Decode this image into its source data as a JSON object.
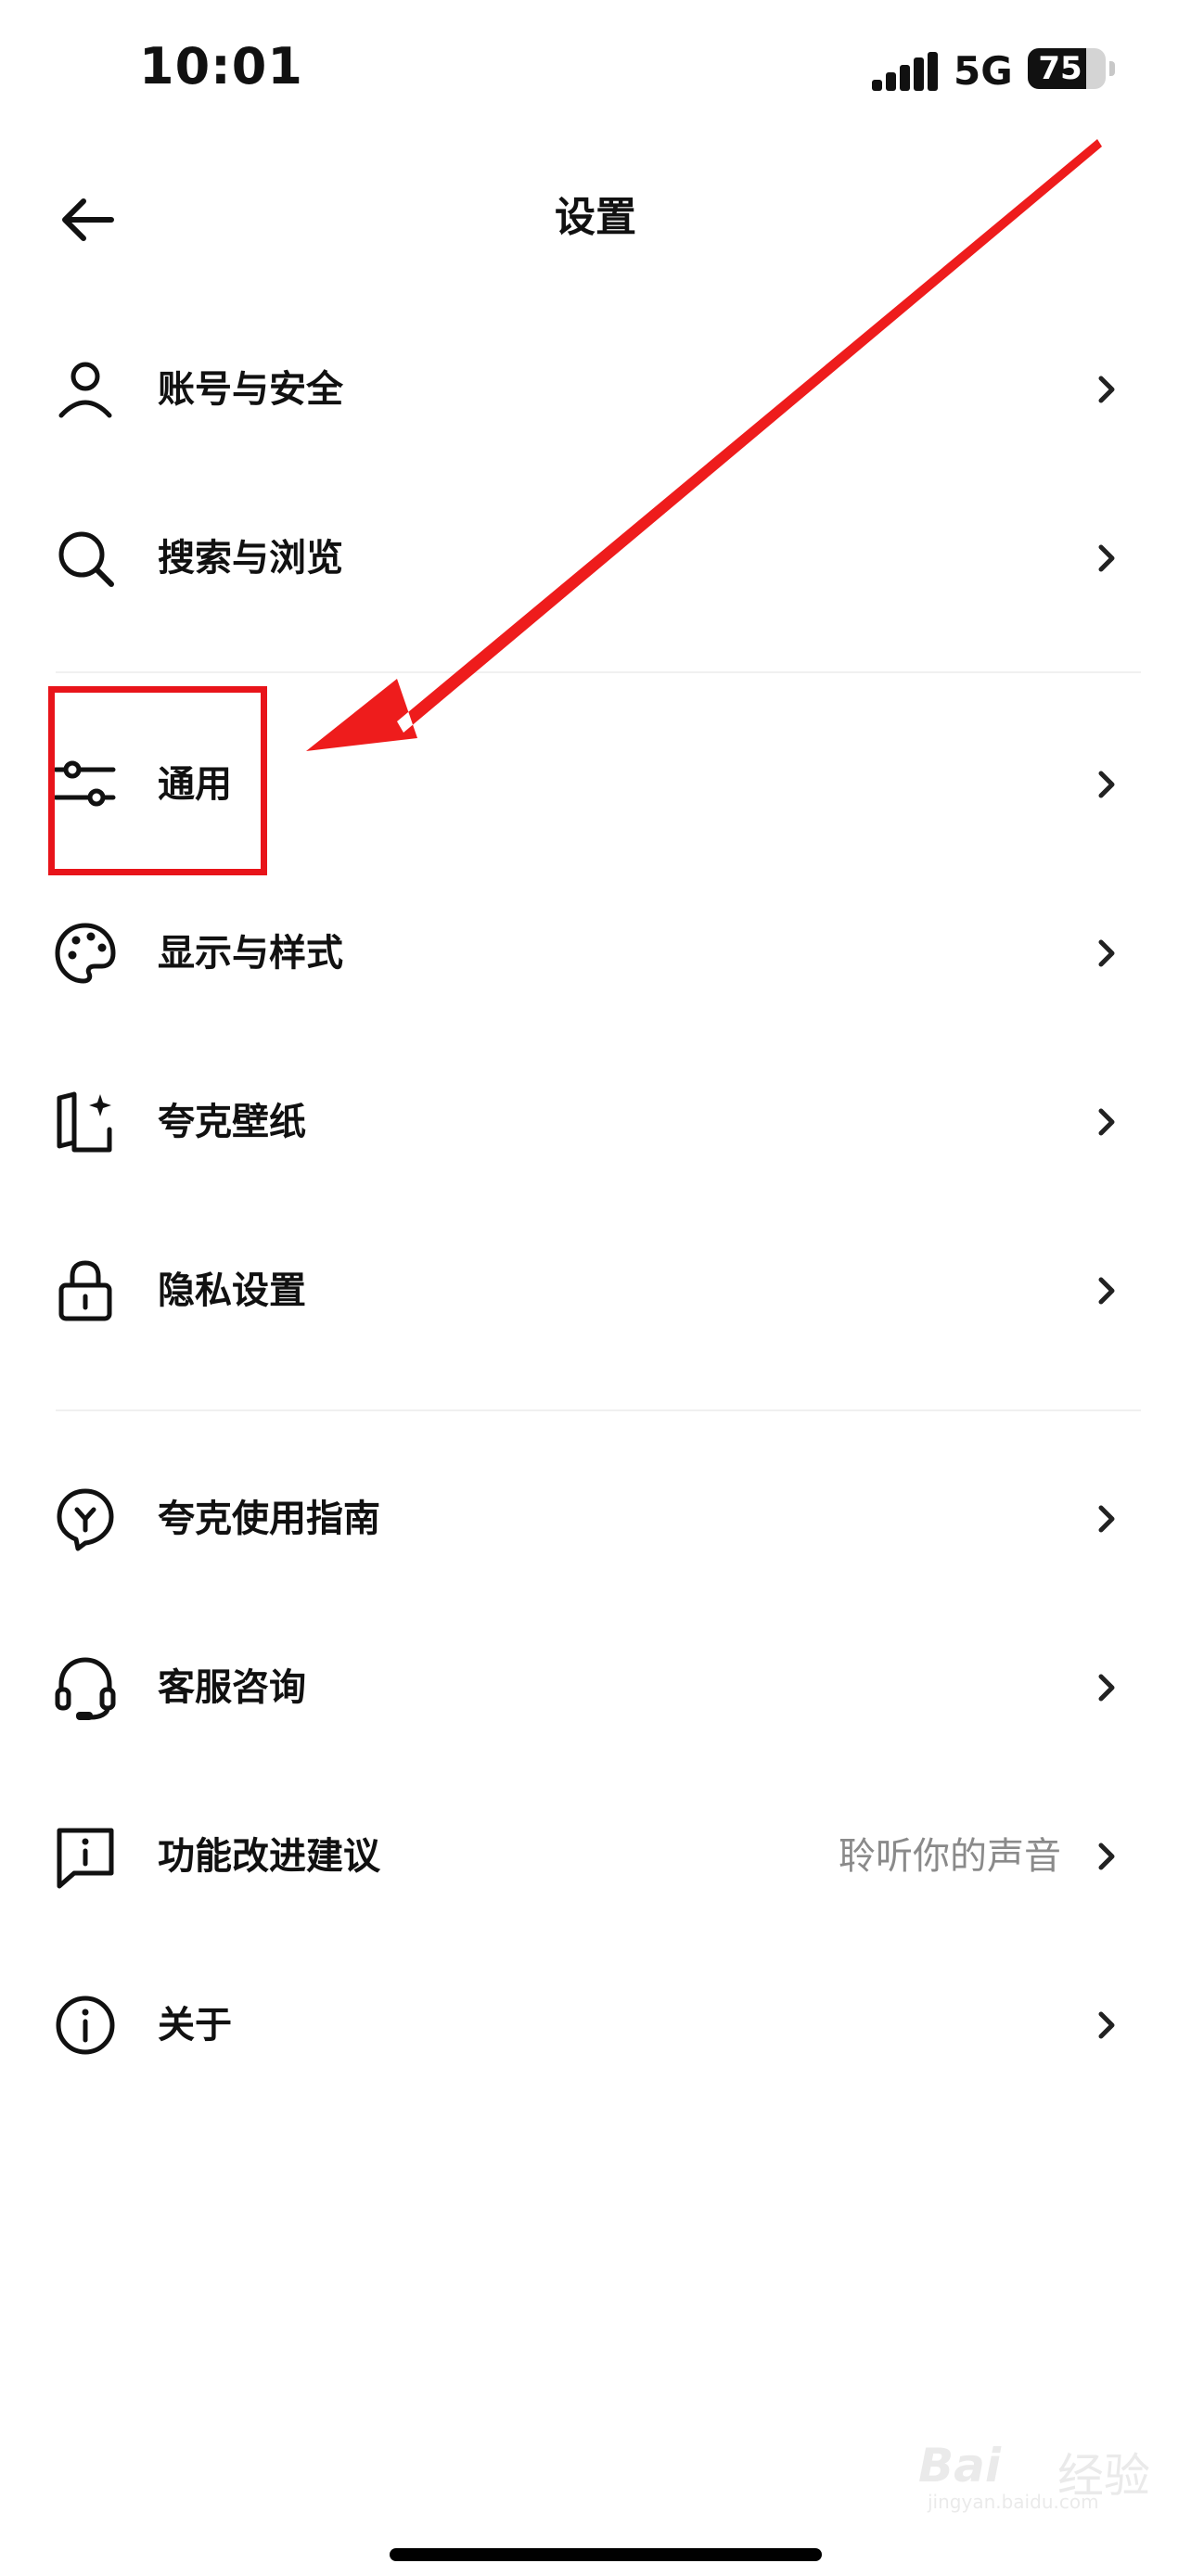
{
  "status_bar": {
    "time": "10:01",
    "network": "5G",
    "battery_level": 75,
    "battery_text": "75"
  },
  "header": {
    "title": "设置",
    "back_icon": "arrow-left-icon"
  },
  "items": [
    {
      "label": "账号与安全",
      "hint": "",
      "icon": "user-icon"
    },
    {
      "label": "搜索与浏览",
      "hint": "",
      "icon": "search-icon"
    },
    {
      "label": "通用",
      "hint": "",
      "icon": "sliders-icon"
    },
    {
      "label": "显示与样式",
      "hint": "",
      "icon": "palette-icon"
    },
    {
      "label": "夸克壁纸",
      "hint": "",
      "icon": "wallpaper-sparkle-icon"
    },
    {
      "label": "隐私设置",
      "hint": "",
      "icon": "lock-icon"
    },
    {
      "label": "夸克使用指南",
      "hint": "",
      "icon": "guide-bulb-icon"
    },
    {
      "label": "客服咨询",
      "hint": "",
      "icon": "headset-icon"
    },
    {
      "label": "功能改进建议",
      "hint": "聆听你的声音",
      "icon": "feedback-icon"
    },
    {
      "label": "关于",
      "hint": "",
      "icon": "info-icon"
    }
  ],
  "annotation": {
    "highlight_color": "#e8141a",
    "arrow_color": "#ee1c1c"
  },
  "watermark": {
    "brand": "Bai",
    "sub": "经验",
    "url": "jingyan.baidu.com"
  }
}
